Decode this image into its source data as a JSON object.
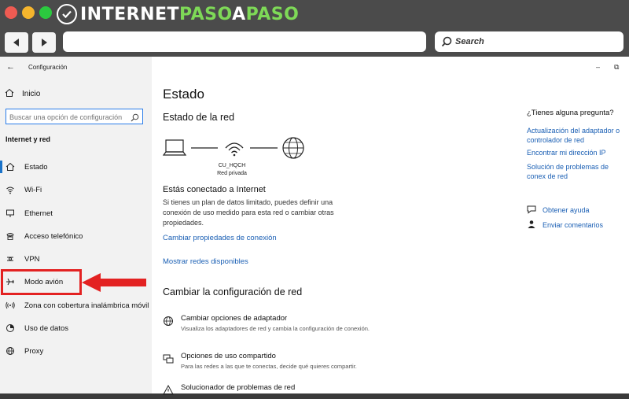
{
  "brand": {
    "logo_part1": "INTERNET",
    "logo_part2": "PASO",
    "logo_part3": "A",
    "logo_part4": "PASO",
    "accent_color": "#7ed957"
  },
  "browser": {
    "url_value": "",
    "search_placeholder": "Search"
  },
  "settings_window": {
    "title": "Configuración"
  },
  "sidebar": {
    "home_label": "Inicio",
    "search_placeholder": "Buscar una opción de configuración",
    "section_label": "Internet y red",
    "items": [
      {
        "label": "Estado",
        "icon": "home-icon",
        "active": true
      },
      {
        "label": "Wi-Fi",
        "icon": "wifi-icon"
      },
      {
        "label": "Ethernet",
        "icon": "ethernet-icon"
      },
      {
        "label": "Acceso telefónico",
        "icon": "dialup-icon"
      },
      {
        "label": "VPN",
        "icon": "vpn-icon"
      },
      {
        "label": "Modo avión",
        "icon": "airplane-icon",
        "highlighted": true
      },
      {
        "label": "Zona con cobertura inalámbrica móvil",
        "icon": "hotspot-icon"
      },
      {
        "label": "Uso de datos",
        "icon": "data-usage-icon"
      },
      {
        "label": "Proxy",
        "icon": "globe-icon"
      }
    ]
  },
  "main": {
    "title": "Estado",
    "network_status_heading": "Estado de la red",
    "network_name": "CU_HQCH",
    "network_type": "Red privada",
    "connected_text": "Estás conectado a Internet",
    "description": "Si tienes un plan de datos limitado, puedes definir una conexión de uso medido para esta red o cambiar otras propiedades.",
    "link_change_properties": "Cambiar propiedades de conexión",
    "link_show_networks": "Mostrar redes disponibles",
    "change_config_heading": "Cambiar la configuración de red",
    "options": [
      {
        "title": "Cambiar opciones de adaptador",
        "desc": "Visualiza los adaptadores de red y cambia la configuración de conexión.",
        "icon": "adapter-icon"
      },
      {
        "title": "Opciones de uso compartido",
        "desc": "Para las redes a las que te conectas, decide qué quieres compartir.",
        "icon": "sharing-icon"
      },
      {
        "title": "Solucionador de problemas de red",
        "desc": "",
        "icon": "warning-icon"
      }
    ]
  },
  "right_panel": {
    "question": "¿Tienes alguna pregunta?",
    "links": [
      "Actualización del adaptador o controlador de red",
      "Encontrar mi dirección IP",
      "Solución de problemas de conex de red"
    ],
    "get_help": "Obtener ayuda",
    "send_feedback": "Enviar comentarios"
  }
}
